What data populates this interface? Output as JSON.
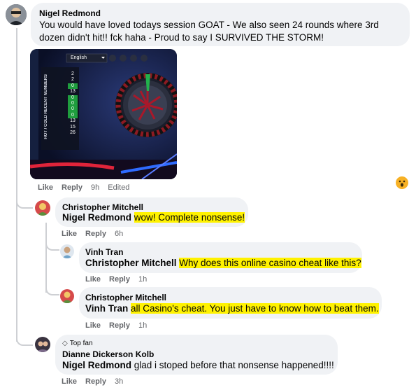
{
  "comments": [
    {
      "author": "Nigel Redmond",
      "text": "You would have loved todays session GOAT - We also seen 24 rounds where 3rd dozen didn't hit!! fck haha - Proud to say I SURVIVED THE STORM!",
      "actions": {
        "like": "Like",
        "reply": "Reply",
        "time": "9h",
        "edited": "Edited"
      },
      "reaction_icon": "wow-emoji-icon",
      "screenshot": {
        "language": "English",
        "panel_labels": [
          "RECENT NUMBERS",
          "HOT / COLD"
        ],
        "recent_numbers": [
          "2",
          "2",
          "0",
          "13",
          "0",
          "0",
          "0",
          "0",
          "13",
          "15",
          "26"
        ]
      }
    },
    {
      "author": "Christopher Mitchell",
      "mention": "Nigel Redmond",
      "text": "wow! Complete nonsense!",
      "actions": {
        "like": "Like",
        "reply": "Reply",
        "time": "6h"
      }
    },
    {
      "author": "Vinh Tran",
      "mention": "Christopher Mitchell",
      "text": "Why does this online casino cheat like this?",
      "actions": {
        "like": "Like",
        "reply": "Reply",
        "time": "1h"
      }
    },
    {
      "author": "Christopher Mitchell",
      "mention": "Vinh Tran",
      "text": "all Casino's cheat. You just have to know how to beat them.",
      "actions": {
        "like": "Like",
        "reply": "Reply",
        "time": "1h"
      }
    },
    {
      "badge": "Top fan",
      "author": "Dianne Dickerson Kolb",
      "mention": "Nigel Redmond",
      "text": "glad i stoped before that nonsense happened!!!!",
      "actions": {
        "like": "Like",
        "reply": "Reply",
        "time": "3h"
      }
    }
  ],
  "colors": {
    "bubble": "#f0f2f5",
    "highlight": "#fff200",
    "meta": "#65676b"
  }
}
